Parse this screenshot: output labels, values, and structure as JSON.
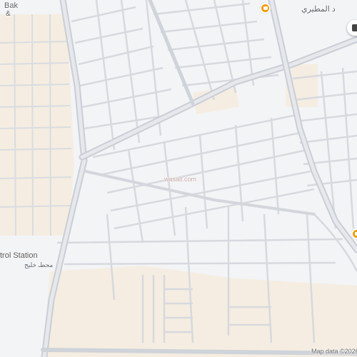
{
  "labels": {
    "top_left_name": "Bak",
    "top_left_amp": "&",
    "top_right_street": "د المطيري",
    "watermark": "wasalt.com",
    "station_en": "trol Station",
    "station_ar": "محطـ خليج",
    "map_data": "Map data ©2026"
  },
  "pois": [
    {
      "name": "restaurant",
      "color": "#f29900"
    },
    {
      "name": "restaurant",
      "color": "#f29900"
    }
  ],
  "colors": {
    "background": "#f3f4f6",
    "block": "#e9ebee",
    "sand": "#f4ecdf",
    "road": "#d6d9de",
    "major_road": "#c9ced6",
    "major_road_fill": "#e3e6ea",
    "poi_orange": "#f29900"
  }
}
